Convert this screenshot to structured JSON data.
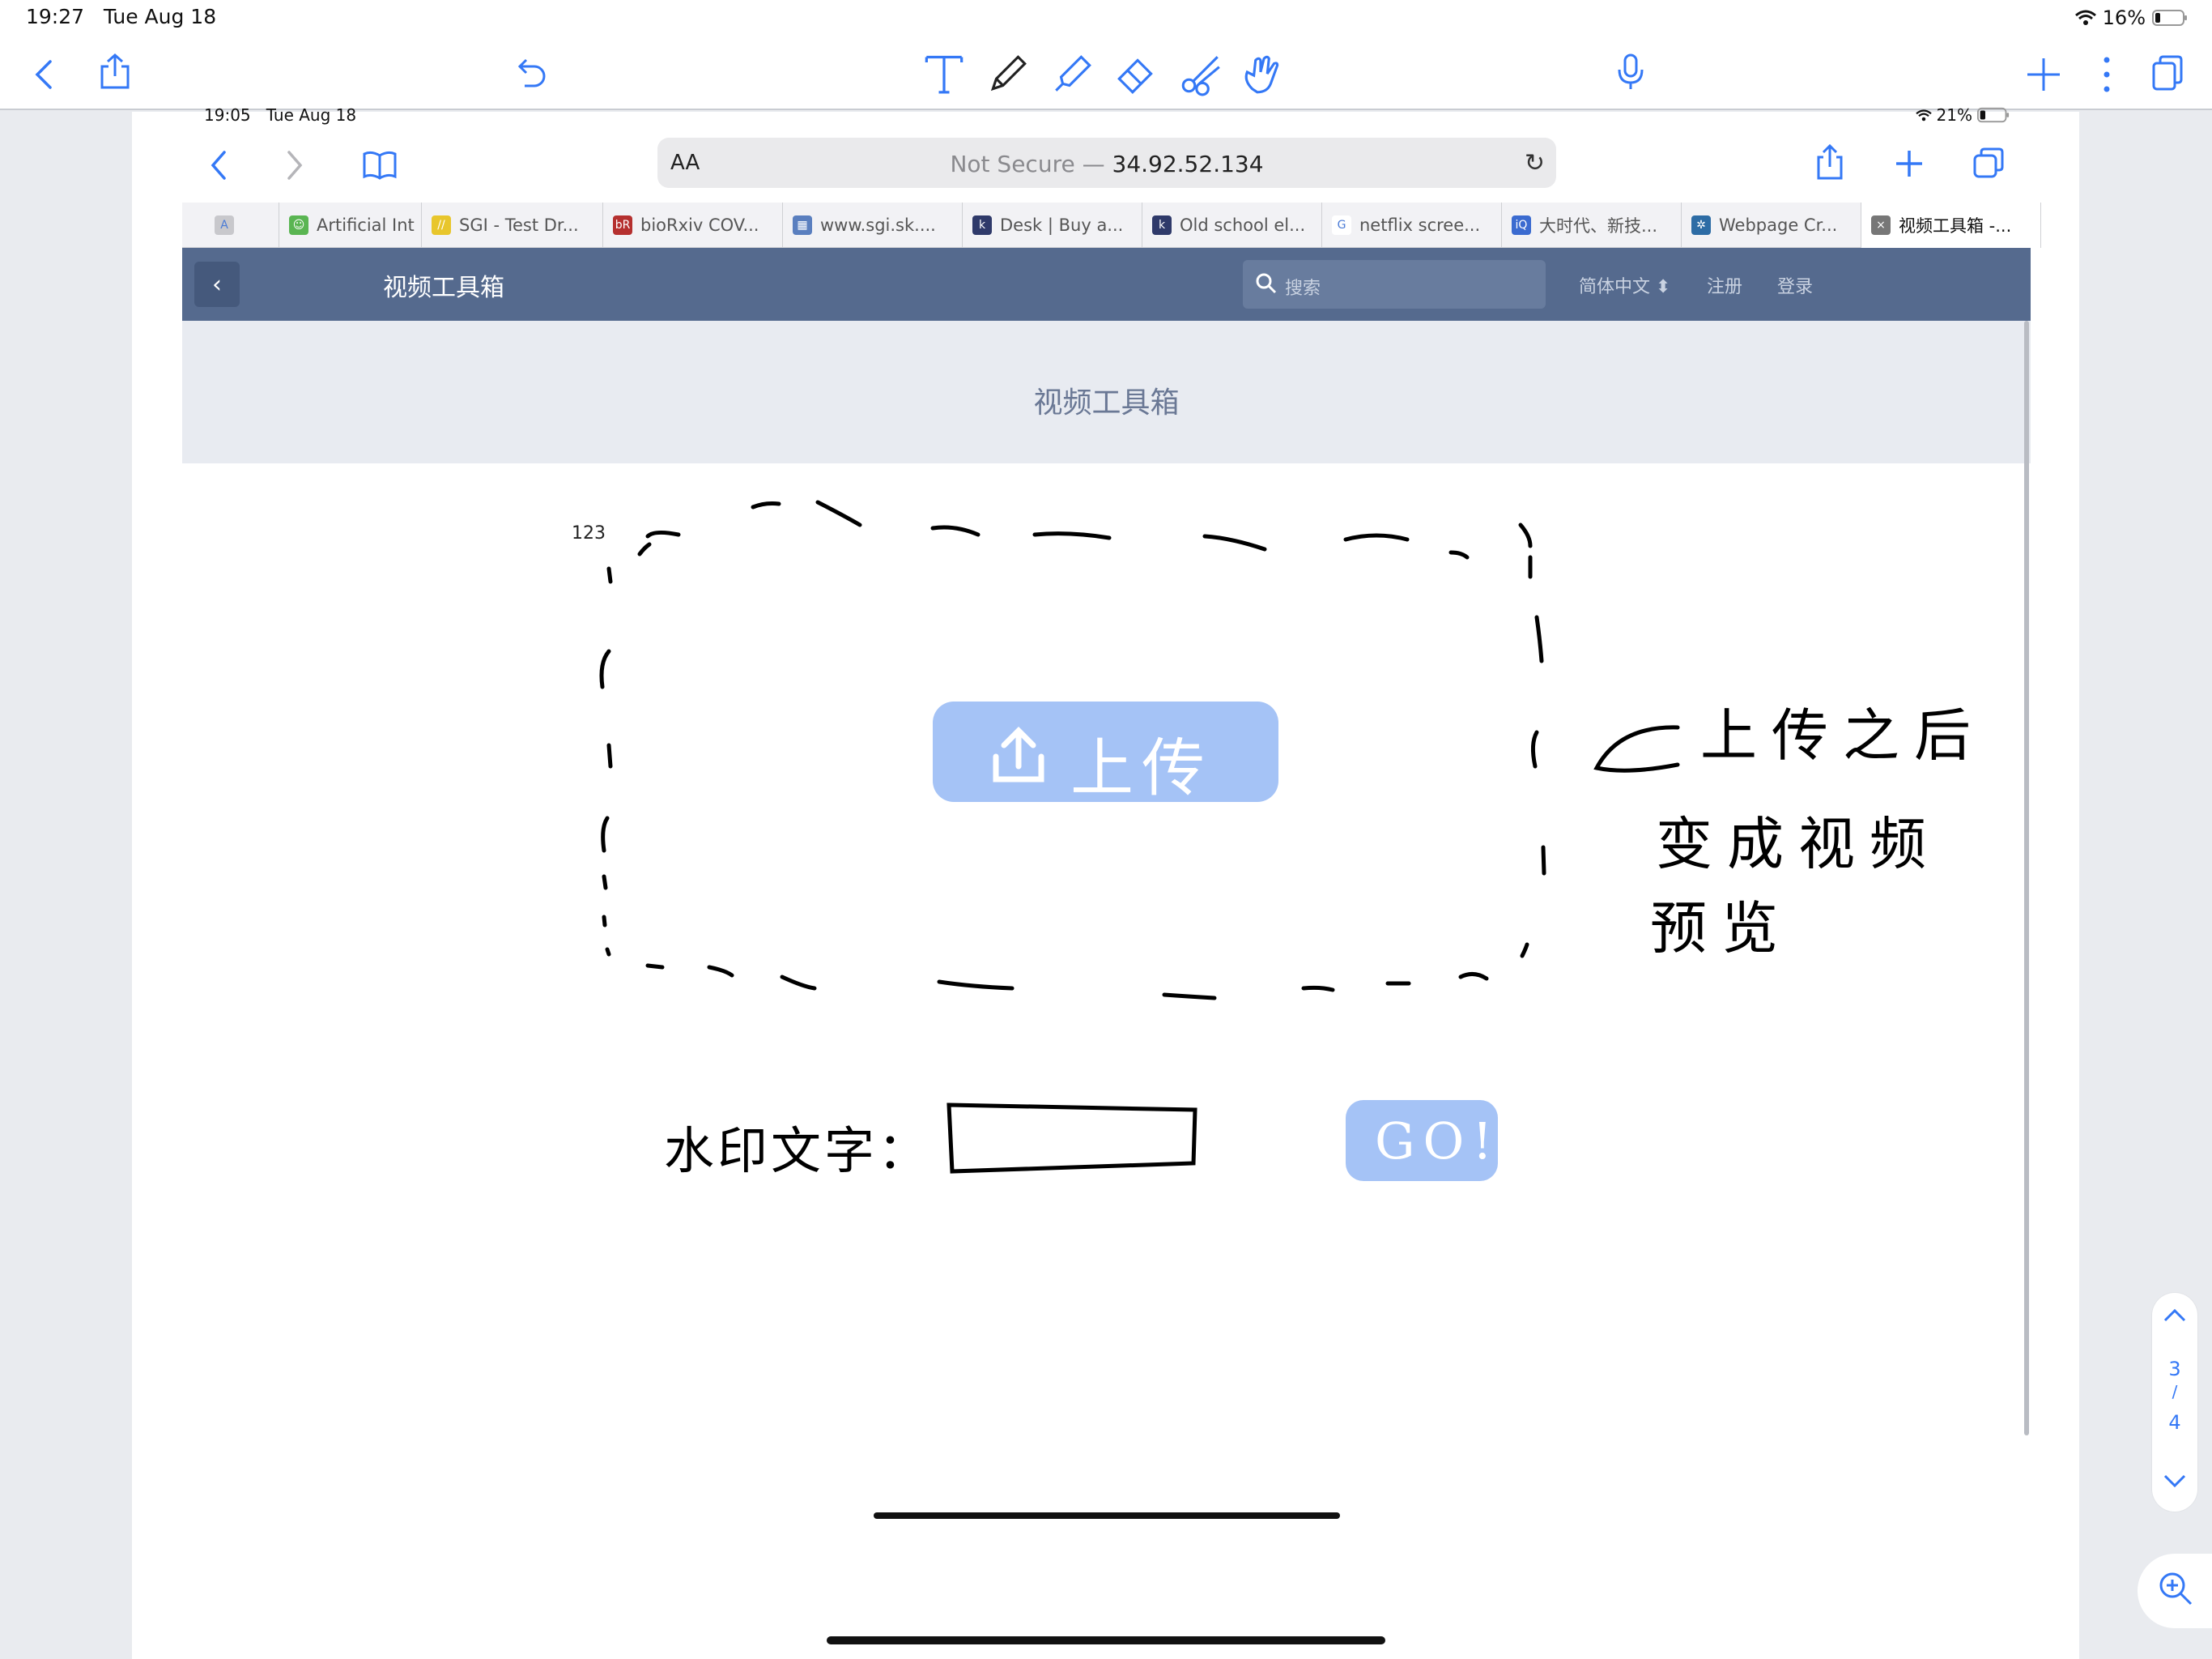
{
  "outer_status": {
    "time": "19:27",
    "date": "Tue Aug 18",
    "battery": "16%"
  },
  "outer_toolbar": {
    "icons": [
      "back-chevron-icon",
      "share-icon",
      "undo-icon",
      "text-tool-icon",
      "pen-icon",
      "highlighter-icon",
      "eraser-icon",
      "scissors-icon",
      "hand-icon",
      "microphone-icon",
      "add-icon",
      "more-icon",
      "pages-icon"
    ]
  },
  "inner_status": {
    "time": "19:05",
    "date": "Tue Aug 18",
    "battery": "21%"
  },
  "safari": {
    "aa": "AA",
    "url_prefix": "Not Secure —",
    "url_host": "34.92.52.134"
  },
  "tabs": [
    {
      "label": "",
      "icon": "A",
      "color": "#c8c8cc"
    },
    {
      "label": "Artificial Int",
      "icon": "☺",
      "color": "#5ab552"
    },
    {
      "label": "SGI - Test Dr...",
      "icon": "//",
      "color": "#e8c62c"
    },
    {
      "label": "bioRxiv COV...",
      "icon": "bR",
      "color": "#b5302f"
    },
    {
      "label": "www.sgi.sk....",
      "icon": "▦",
      "color": "#5a7fbf"
    },
    {
      "label": "Desk | Buy a...",
      "icon": "k",
      "color": "#2f3a6a"
    },
    {
      "label": "Old school el...",
      "icon": "k",
      "color": "#2f3a6a"
    },
    {
      "label": "netflix scree...",
      "icon": "G",
      "color": "#ffffff"
    },
    {
      "label": "大时代、新技...",
      "icon": "iQ",
      "color": "#3b6bd0"
    },
    {
      "label": "Webpage Cr...",
      "icon": "✲",
      "color": "#2d6ca5"
    },
    {
      "label": "视频工具箱 -...",
      "icon": "×",
      "color": "#777777"
    }
  ],
  "site": {
    "nav_title": "视频工具箱",
    "search_placeholder": "搜索",
    "language": "简体中文",
    "register": "注册",
    "login": "登录",
    "hero_title": "视频工具箱"
  },
  "sketch": {
    "number": "123",
    "upload_label": "上传",
    "note": [
      "上传之后",
      "变成视频",
      "预览"
    ],
    "watermark_label": "水印文字：",
    "go_label": "GO!"
  },
  "pager": {
    "current": "3",
    "separator": "/",
    "total": "4"
  },
  "colors": {
    "accent": "#3478f6",
    "nav_bg": "#556a8e",
    "hero_bg": "#e8ebf1",
    "button_fill": "#a5c3f6"
  }
}
